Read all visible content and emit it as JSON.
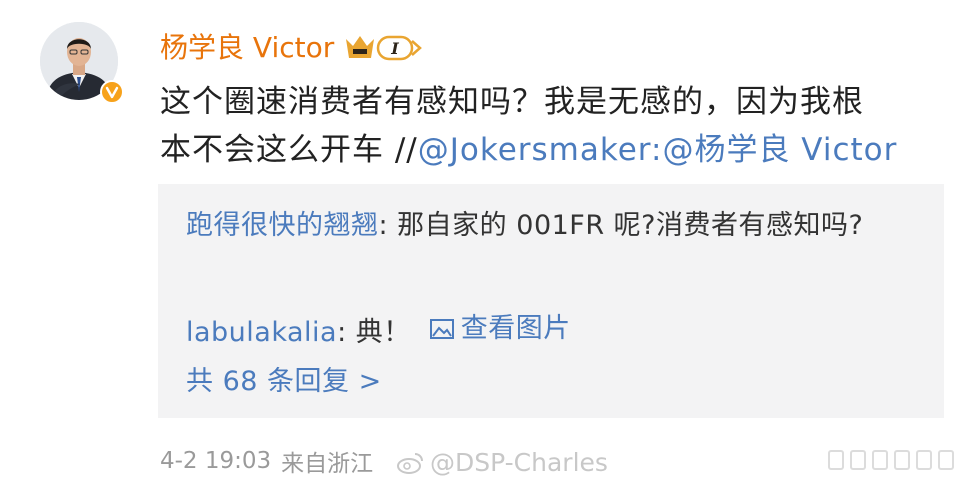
{
  "post": {
    "author": "杨学良 Victor",
    "vip_level": "I",
    "content_line1": "这个圈速消费者有感知吗？我是无感的，因为我根",
    "content_line2_text": "本不会这么开车 //",
    "mention1": "@Jokersmaker",
    "colon": ":",
    "mention2": "@杨学良 Victor"
  },
  "repost": {
    "comment1_user": "跑得很快的翘翘",
    "comment1_text": ": 那自家的 001FR 呢?消费者有感知吗?",
    "comment2_user": "labulakalia",
    "comment2_text": ": 典！",
    "comment2_link": "查看图片",
    "reply_count": "共 68 条回复 >"
  },
  "footer": {
    "time": "4-2 19:03",
    "source": "来自浙江",
    "watermark": "@DSP-Charles"
  },
  "colors": {
    "author": "#e8740b",
    "link": "#4b7bbd",
    "verified_badge": "#f7a21b",
    "vip_crown": "#e9a531"
  },
  "icons": {
    "verified": "verified-v-icon",
    "vip": "vip-crown-icon",
    "image_link": "image-icon",
    "watermark_logo": "weibo-logo-icon",
    "more": "more-dots-icon"
  }
}
